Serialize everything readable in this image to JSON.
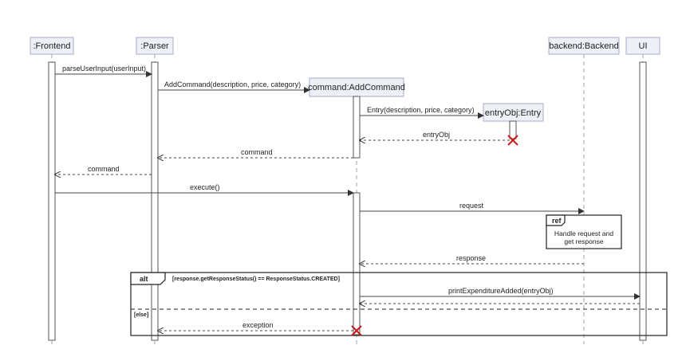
{
  "participants": {
    "frontend": ":Frontend",
    "parser": ":Parser",
    "command": "command:AddCommand",
    "entry": "entryObj:Entry",
    "backend": "backend:Backend",
    "ui": "UI"
  },
  "messages": {
    "parse_user_input": "parseUserInput(userInput)",
    "add_command": "AddCommand(description, price, category)",
    "entry_ctor": "Entry(description, price, category)",
    "entry_return": "entryObj",
    "command_return_parser": "command",
    "command_return_frontend": "command",
    "execute": "execute()",
    "request": "request",
    "response": "response",
    "print_expenditure": "printExpenditureAdded(entryObj)",
    "exception": "exception"
  },
  "ref": {
    "label": "ref",
    "line1": "Handle request and",
    "line2": "get response"
  },
  "alt": {
    "label": "alt",
    "guard": "[response.getResponseStatus() == ResponseStatus.CREATED]",
    "else_guard": "[else]"
  },
  "colors": {
    "participant_fill": "#eef0f8",
    "participant_border": "#a8aac8",
    "destroy_mark": "#cc1b1b"
  }
}
